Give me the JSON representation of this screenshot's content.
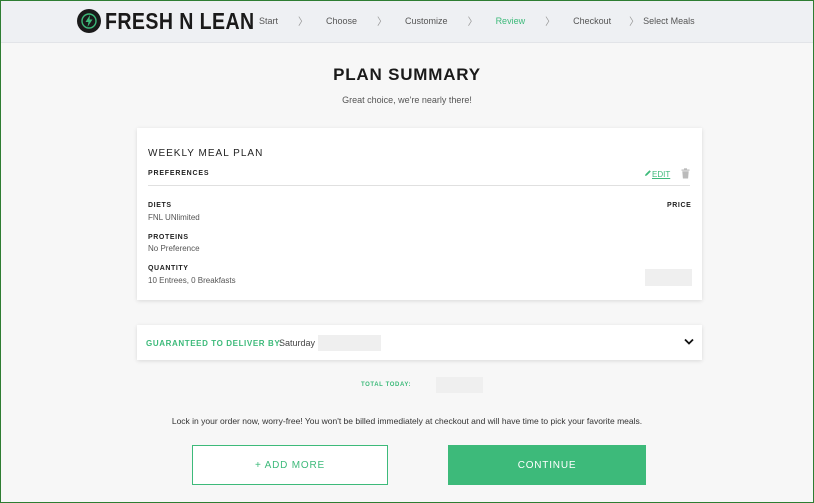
{
  "brand": {
    "logo_text": "FRESH N LEAN",
    "accent_color": "#3dba7a",
    "logo_icon": "lightning-bolt-icon"
  },
  "steps": [
    {
      "label": "Start",
      "active": false
    },
    {
      "label": "Choose",
      "active": false
    },
    {
      "label": "Customize",
      "active": false
    },
    {
      "label": "Review",
      "active": true
    },
    {
      "label": "Checkout",
      "active": false
    },
    {
      "label": "Select Meals",
      "active": false
    }
  ],
  "page": {
    "title": "PLAN SUMMARY",
    "subtitle": "Great choice, we're nearly there!"
  },
  "plan_card": {
    "title": "WEEKLY MEAL PLAN",
    "preferences_label": "PREFERENCES",
    "edit_label": "EDIT",
    "price_label": "PRICE",
    "fields": {
      "diets_label": "DIETS",
      "diets_value": "FNL UNlimited",
      "proteins_label": "PROTEINS",
      "proteins_value": "No Preference",
      "quantity_label": "QUANTITY",
      "quantity_value": "10 Entrees, 0 Breakfasts"
    }
  },
  "delivery": {
    "label": "GUARANTEED TO DELIVER BY:",
    "day": "Saturday"
  },
  "total": {
    "label": "TOTAL TODAY:"
  },
  "lockin_text": "Lock in your order now, worry-free! You won't be billed immediately at checkout and will have time to pick your favorite meals.",
  "buttons": {
    "add_more": "+ ADD MORE",
    "continue": "CONTINUE"
  }
}
